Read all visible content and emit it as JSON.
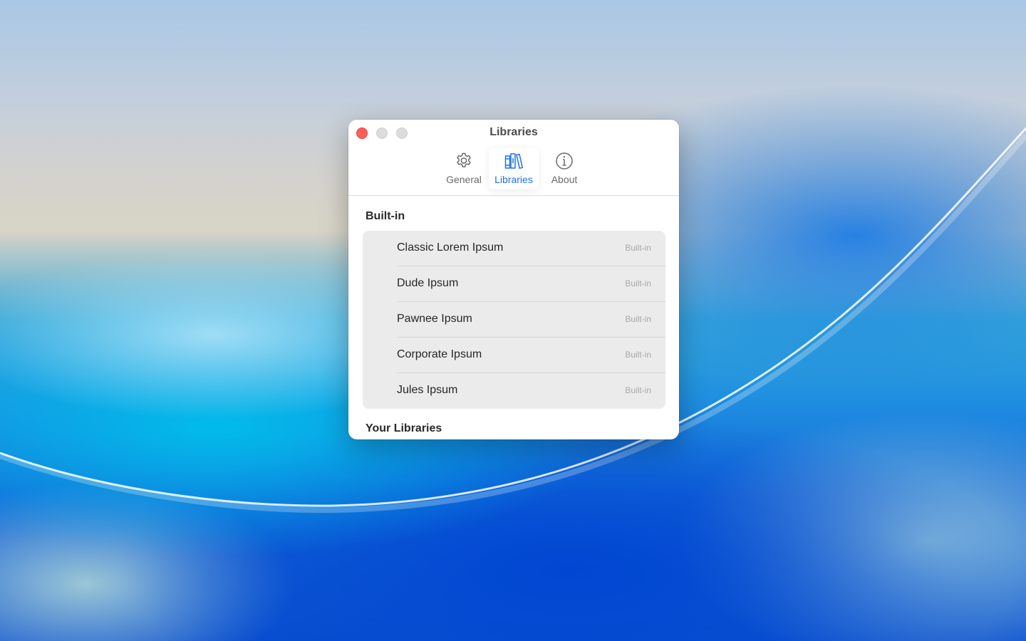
{
  "window": {
    "title": "Libraries"
  },
  "toolbar": {
    "tabs": [
      {
        "label": "General",
        "icon": "gear-icon",
        "selected": false
      },
      {
        "label": "Libraries",
        "icon": "books-icon",
        "selected": true
      },
      {
        "label": "About",
        "icon": "info-circle-icon",
        "selected": false
      }
    ]
  },
  "sections": {
    "builtin": {
      "title": "Built-in",
      "items": [
        {
          "name": "Classic Lorem Ipsum",
          "badge": "Built-in"
        },
        {
          "name": "Dude Ipsum",
          "badge": "Built-in"
        },
        {
          "name": "Pawnee Ipsum",
          "badge": "Built-in"
        },
        {
          "name": "Corporate Ipsum",
          "badge": "Built-in"
        },
        {
          "name": "Jules Ipsum",
          "badge": "Built-in"
        }
      ]
    },
    "yours": {
      "title": "Your Libraries"
    }
  },
  "colors": {
    "accent": "#1a73e8",
    "close": "#fe5f57",
    "inactive_traffic": "#dcdcdc",
    "list_background": "#ebebeb"
  }
}
